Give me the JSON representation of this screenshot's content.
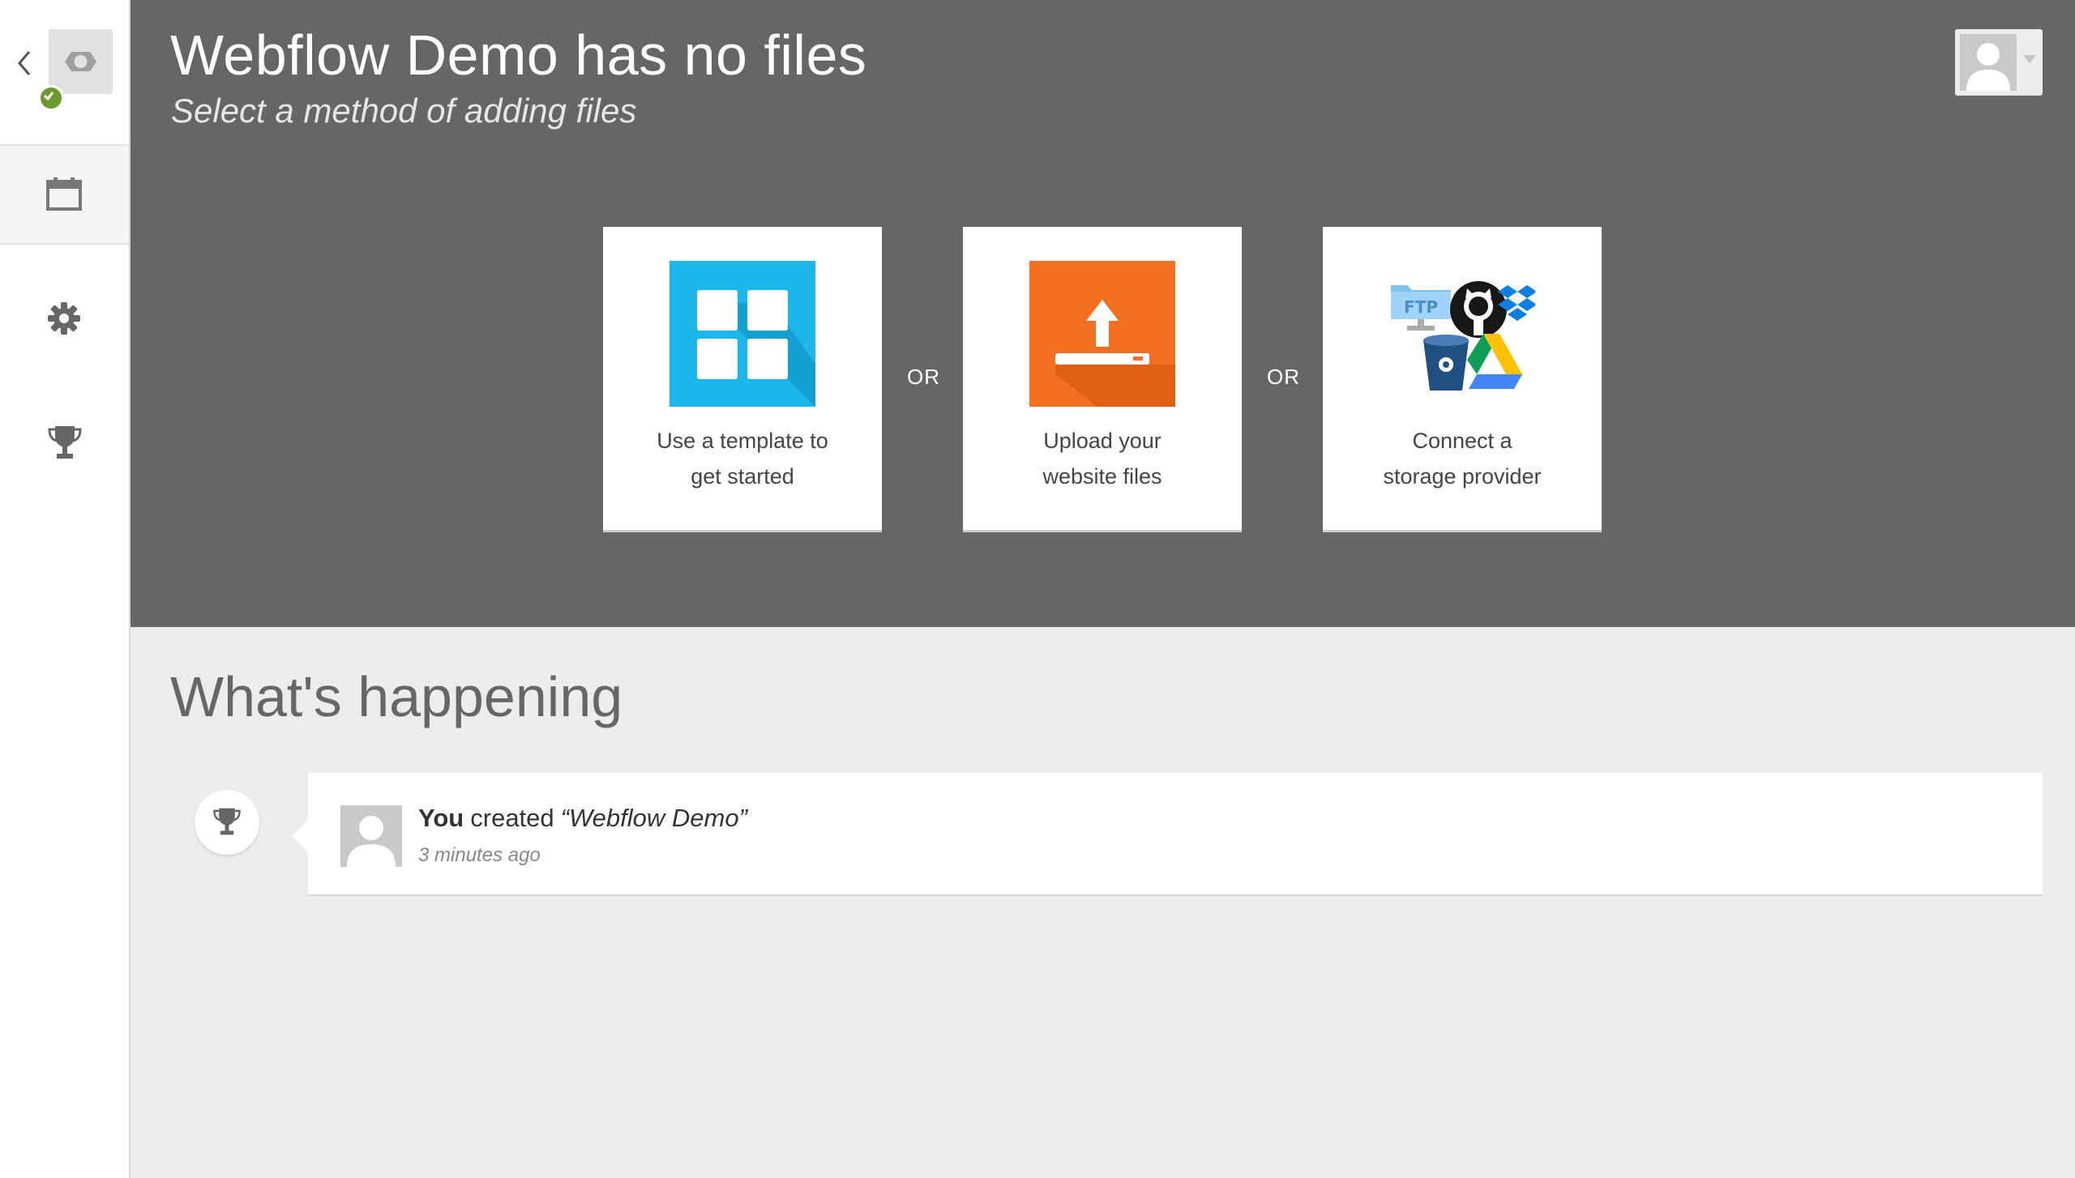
{
  "header": {
    "title": "Webflow Demo has no files",
    "subtitle": "Select a method of adding files"
  },
  "sidebar": {
    "items": [
      {
        "icon": "back-chevron-icon"
      },
      {
        "icon": "project-logo-icon",
        "status": "ok"
      },
      {
        "icon": "calendar-icon",
        "active": true
      },
      {
        "icon": "gear-icon"
      },
      {
        "icon": "trophy-icon"
      }
    ]
  },
  "methods": [
    {
      "line1": "Use a template to",
      "line2": "get started",
      "icon": "template-grid-icon",
      "color": "#1bb6ea"
    },
    {
      "line1": "Upload your",
      "line2": "website files",
      "icon": "upload-icon",
      "color": "#f37021"
    },
    {
      "line1": "Connect a",
      "line2": "storage provider",
      "icon": "storage-providers-icon"
    }
  ],
  "or_label": "OR",
  "activity": {
    "title": "What's happening",
    "items": [
      {
        "actor": "You",
        "verb": "created",
        "object": "“Webflow Demo”",
        "time": "3 minutes ago",
        "icon": "trophy-icon"
      }
    ]
  },
  "colors": {
    "hero_bg": "#666666",
    "page_bg": "#ececec",
    "status_ok": "#6b9a2e"
  }
}
